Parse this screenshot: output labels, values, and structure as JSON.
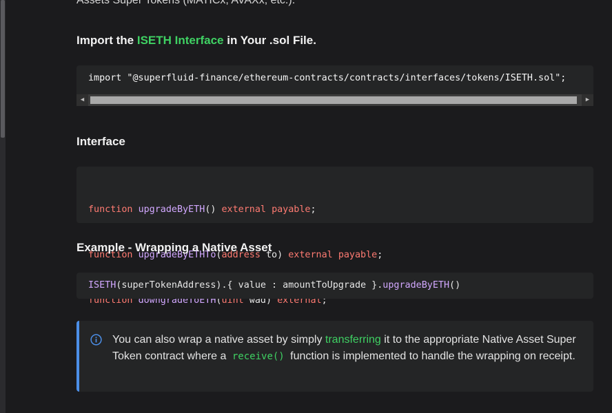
{
  "top_text": "Assets Super Tokens (MATICx, AVAXx, etc.).",
  "heading_import": {
    "pre": "Import the ",
    "link": "ISETH Interface",
    "post": " in Your .sol File."
  },
  "import_code": "import \"@superfluid-finance/ethereum-contracts/contracts/interfaces/tokens/ISETH.sol\";",
  "heading_interface": "Interface",
  "interface_lines": [
    {
      "kw1": "function",
      "fn": "upgradeByETH",
      "p1": "() ",
      "kw2": "external",
      "p2": " ",
      "kw3": "payable",
      "p3": ";"
    },
    {
      "kw1": "function",
      "fn": "upgradeByETHTo",
      "p1": "(",
      "kw2": "address",
      "p2": " to) ",
      "kw3": "external",
      "p3": " ",
      "kw4": "payable",
      "p4": ";"
    },
    {
      "kw1": "function",
      "fn": "downgradeToETH",
      "p1": "(",
      "kw2": "uint",
      "p2": " wad) ",
      "kw3": "external",
      "p3": ";"
    }
  ],
  "heading_example": "Example - Wrapping a Native Asset",
  "example_code": {
    "fn1": "ISETH",
    "mid": "(superTokenAddress).{ value : amountToUpgrade }.",
    "fn2": "upgradeByETH",
    "end": "()"
  },
  "info": {
    "icon": "info-icon",
    "t1": "You can also wrap a native asset by simply ",
    "link": "transferring",
    "t2": " it to the appropriate Native Asset Super Token contract where a ",
    "code": "receive()",
    "t3": " function is implemented to handle the wrapping on receipt.",
    "accent": "#4c8fe8"
  },
  "colors": {
    "background": "#1b1b1d",
    "link": "#3fd163",
    "keyword": "#ff7b72",
    "function": "#d2a8ff"
  }
}
